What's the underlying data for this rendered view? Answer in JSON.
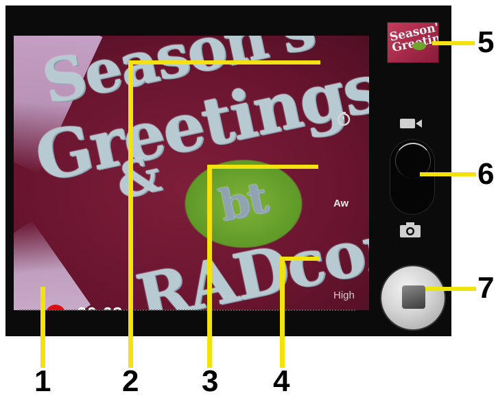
{
  "viewfinder": {
    "scene_text": [
      "Season's",
      "Greetings",
      "&",
      "bt",
      "RADcomms"
    ]
  },
  "recording": {
    "elapsed": "00:03"
  },
  "overlays": {
    "timer_icon": "timer-icon",
    "white_balance": "Aw",
    "quality": "High"
  },
  "thumbnail": {
    "text": "Season's Greetings"
  },
  "controls": {
    "mode_icons": [
      "video-camera-icon",
      "photo-camera-icon"
    ],
    "shutter_icon": "stop-icon"
  },
  "callouts": [
    "1",
    "2",
    "3",
    "4",
    "5",
    "6",
    "7"
  ],
  "colors": {
    "callout": "#f2e20d",
    "record": "#d90e0e",
    "background": "#0b0b0b"
  }
}
